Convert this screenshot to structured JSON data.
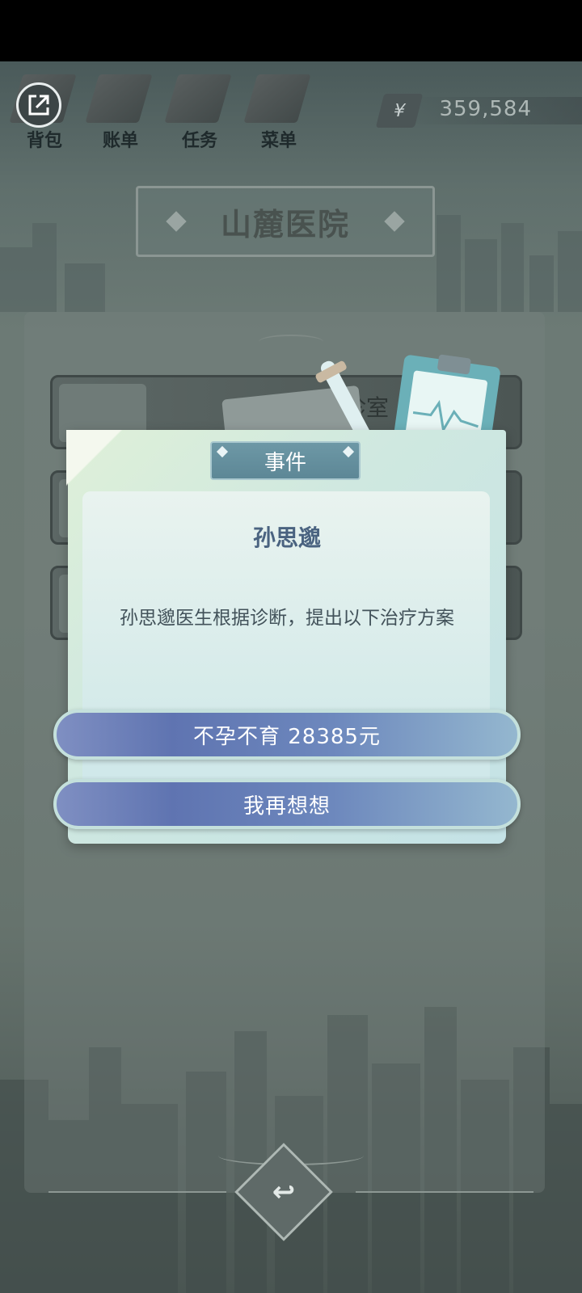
{
  "toolbar": {
    "items": [
      {
        "label": "背包",
        "icon": "backpack-icon"
      },
      {
        "label": "账单",
        "icon": "bill-icon"
      },
      {
        "label": "任务",
        "icon": "task-icon"
      },
      {
        "label": "菜单",
        "icon": "menu-icon"
      }
    ],
    "currency_symbol": "¥",
    "money": "359,584"
  },
  "hospital": {
    "name": "山麓医院"
  },
  "rooms": [
    {
      "label": "诊室"
    }
  ],
  "dialog": {
    "tab_title": "事件",
    "doctor_name": "孙思邈",
    "message": "孙思邈医生根据诊断，提出以下治疗方案",
    "options": [
      {
        "label": "不孕不育 28385元"
      },
      {
        "label": "我再想想"
      }
    ]
  },
  "colors": {
    "option_button": "#5f74b1",
    "tab_bg": "#6d98a6",
    "doctor_name": "#4a6380"
  }
}
